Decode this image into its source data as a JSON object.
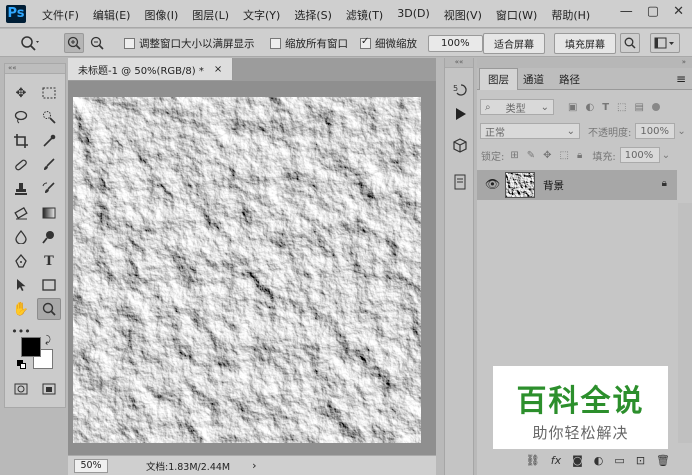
{
  "app": {
    "logo": "Ps"
  },
  "menu": [
    "文件(F)",
    "编辑(E)",
    "图像(I)",
    "图层(L)",
    "文字(Y)",
    "选择(S)",
    "滤镜(T)",
    "3D(D)",
    "视图(V)",
    "窗口(W)",
    "帮助(H)"
  ],
  "window_controls": [
    "—",
    "▢",
    "✕"
  ],
  "options": {
    "resize_windows": "调整窗口大小以满屏显示",
    "zoom_all": "缩放所有窗口",
    "scrubby_zoom": "细微缩放",
    "zoom_value": "100%",
    "fit_screen": "适合屏幕",
    "fill_screen": "填充屏幕"
  },
  "document": {
    "tab_title": "未标题-1 @ 50%(RGB/8) *",
    "tab_close": "×",
    "status_zoom": "50%",
    "status_doc": "文档:1.83M/2.44M",
    "status_arrow": "›"
  },
  "layers_panel": {
    "tabs": [
      "图层",
      "通道",
      "路径"
    ],
    "filter_kind": "类型",
    "blend_mode": "正常",
    "opacity_label": "不透明度:",
    "opacity_value": "100%",
    "lock_label": "锁定:",
    "fill_label": "填充:",
    "fill_value": "100%",
    "layer_name": "背景"
  },
  "watermark": {
    "line1": "百科全说",
    "line2": "助你轻松解决"
  },
  "colors": {
    "foreground": "#000000",
    "background": "#ffffff",
    "ps_blue": "#31a8ff"
  }
}
